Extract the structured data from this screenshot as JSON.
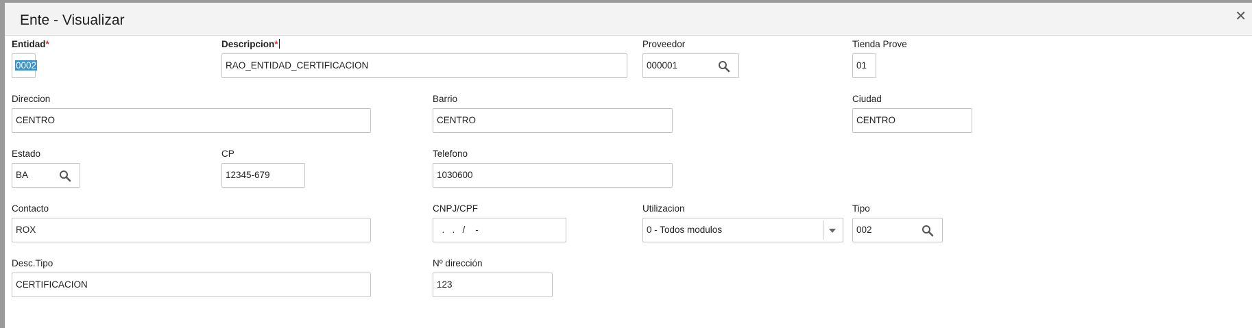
{
  "window": {
    "title": "Ente - Visualizar",
    "close_symbol": "✕"
  },
  "fields": {
    "entidad": {
      "label": "Entidad",
      "required_mark": "*",
      "value": "0002"
    },
    "descripcion": {
      "label": "Descripcion",
      "required_mark": "*",
      "value": "RAO_ENTIDAD_CERTIFICACION"
    },
    "proveedor": {
      "label": "Proveedor",
      "value": "000001",
      "icon": "search-icon"
    },
    "tienda_prove": {
      "label": "Tienda Prove",
      "value": "01"
    },
    "direccion": {
      "label": "Direccion",
      "value": "CENTRO"
    },
    "barrio": {
      "label": "Barrio",
      "value": "CENTRO"
    },
    "ciudad": {
      "label": "Ciudad",
      "value": "CENTRO"
    },
    "estado": {
      "label": "Estado",
      "value": "BA",
      "icon": "search-icon"
    },
    "cp": {
      "label": "CP",
      "value": "12345-679"
    },
    "telefono": {
      "label": "Telefono",
      "value": "1030600"
    },
    "contacto": {
      "label": "Contacto",
      "value": "ROX"
    },
    "cnpj_cpf": {
      "label": "CNPJ/CPF",
      "value": "  .   .   /    -"
    },
    "utilizacion": {
      "label": "Utilizacion",
      "selected": "0 - Todos modulos"
    },
    "tipo": {
      "label": "Tipo",
      "value": "002",
      "icon": "search-icon"
    },
    "desc_tipo": {
      "label": "Desc.Tipo",
      "value": "CERTIFICACION"
    },
    "n_direccion": {
      "label": "Nº dirección",
      "value": "123"
    }
  },
  "colors": {
    "required": "#e0312e",
    "selection": "#3f93c6",
    "border": "#c4c4c4"
  }
}
